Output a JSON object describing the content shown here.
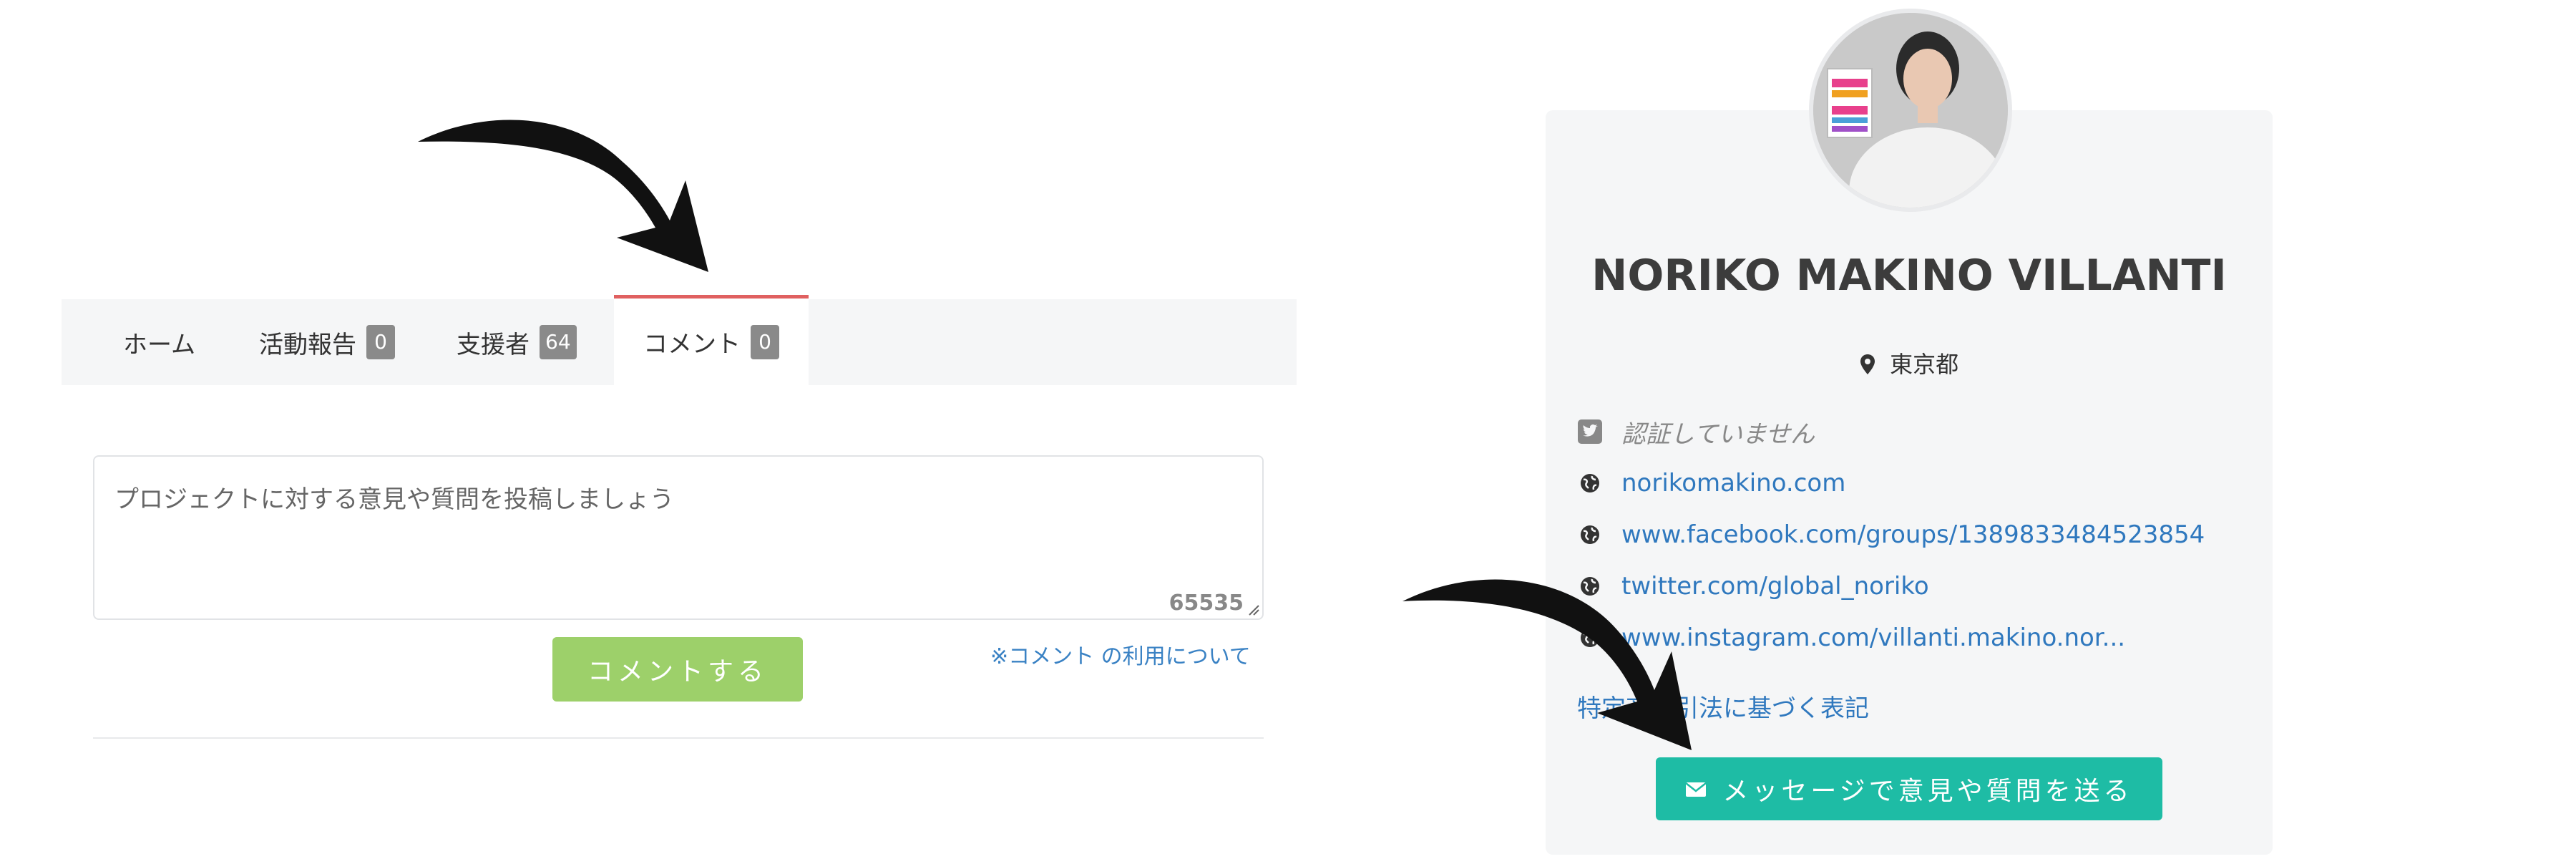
{
  "tabs": [
    {
      "label": "ホーム",
      "badge": null
    },
    {
      "label": "活動報告",
      "badge": "0"
    },
    {
      "label": "支援者",
      "badge": "64"
    },
    {
      "label": "コメント",
      "badge": "0",
      "active": true
    }
  ],
  "comment_form": {
    "placeholder": "プロジェクトに対する意見や質問を投稿しましょう",
    "char_counter": "65535",
    "submit_label": "コメントする",
    "usage_link": "※コメント の利用について"
  },
  "profile": {
    "name": "NORIKO MAKINO VILLANTI",
    "location": "東京都",
    "twitter_status": "認証していません",
    "links": [
      "norikomakino.com",
      "www.facebook.com/groups/1389833484523854",
      "twitter.com/global_noriko",
      "www.instagram.com/villanti.makino.nor..."
    ],
    "legal_link": "特定商取引法に基づく表記",
    "message_button": "メッセージで意見や質問を送る"
  },
  "colors": {
    "active_tab_border": "#e06060",
    "badge": "#8a8a8a",
    "submit_button": "#9dd06a",
    "message_button": "#1ebca5",
    "link": "#2f78be",
    "panel_background": "#f5f6f7"
  },
  "icons": {
    "twitter": "twitter-square-icon",
    "globe": "globe-icon",
    "location": "map-marker-icon",
    "mail": "envelope-icon"
  }
}
